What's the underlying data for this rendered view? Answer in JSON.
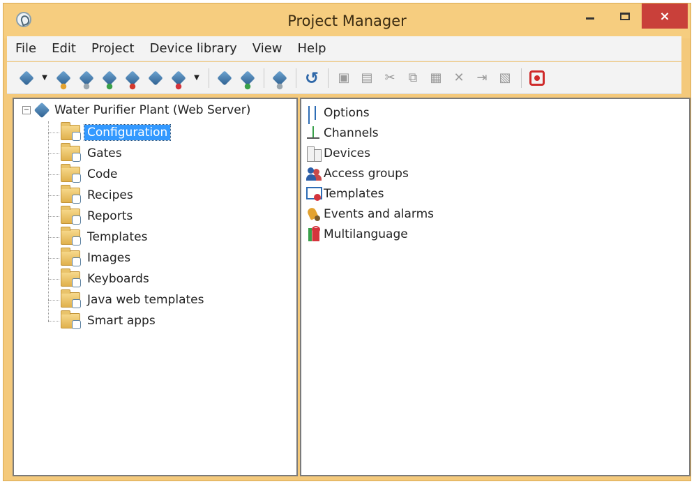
{
  "window": {
    "title": "Project Manager",
    "close_glyph": "×"
  },
  "menu": [
    "File",
    "Edit",
    "Project",
    "Device library",
    "View",
    "Help"
  ],
  "toolbar": {
    "icons": [
      "project-cube-icon",
      "dropdown-arrow-icon",
      "open-project-icon",
      "search-project-icon",
      "add-project-icon",
      "delete-project-icon",
      "project-properties-icon",
      "favorite-project-icon",
      "dropdown-arrow-icon",
      "download-icon",
      "upload-icon",
      "simulate-icon",
      "refresh-icon",
      "new-icon",
      "rename-icon",
      "cut-icon",
      "copy-icon",
      "paste-icon",
      "delete-icon",
      "export-icon",
      "import-icon",
      "stop-icon"
    ]
  },
  "tree": {
    "root": {
      "label": "Water Purifier Plant (Web Server)",
      "expander": "−"
    },
    "items": [
      {
        "label": "Configuration",
        "selected": true
      },
      {
        "label": "Gates"
      },
      {
        "label": "Code"
      },
      {
        "label": "Recipes"
      },
      {
        "label": "Reports"
      },
      {
        "label": "Templates"
      },
      {
        "label": "Images"
      },
      {
        "label": "Keyboards"
      },
      {
        "label": "Java web templates"
      },
      {
        "label": "Smart apps"
      }
    ]
  },
  "list": {
    "items": [
      {
        "label": "Options",
        "icon": "options-icon"
      },
      {
        "label": "Channels",
        "icon": "channels-icon"
      },
      {
        "label": "Devices",
        "icon": "devices-icon"
      },
      {
        "label": "Access groups",
        "icon": "access-groups-icon"
      },
      {
        "label": "Templates",
        "icon": "templates-icon"
      },
      {
        "label": "Events and alarms",
        "icon": "events-alarms-icon"
      },
      {
        "label": "Multilanguage",
        "icon": "multilanguage-icon"
      }
    ]
  },
  "colors": {
    "titlebar": "#f6cd7f",
    "close_button": "#c9403a",
    "selection": "#3399ff"
  }
}
